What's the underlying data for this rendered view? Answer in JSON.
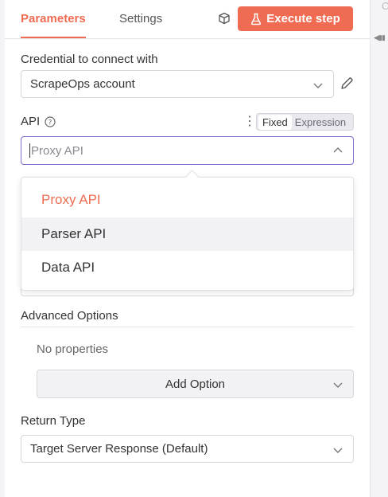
{
  "tabs": {
    "parameters": "Parameters",
    "settings": "Settings"
  },
  "header": {
    "execute_label": "Execute step",
    "accent_color": "#ef6c53"
  },
  "credential": {
    "label": "Credential to connect with",
    "value": "ScrapeOps account"
  },
  "api": {
    "label": "API",
    "mode_fixed": "Fixed",
    "mode_expression": "Expression",
    "input_placeholder": "Proxy API",
    "options": [
      "Proxy API",
      "Parser API",
      "Data API"
    ],
    "selected": "Proxy API",
    "hovered": "Parser API"
  },
  "advanced": {
    "label": "Advanced Options",
    "empty_text": "No properties",
    "add_label": "Add Option"
  },
  "return_type": {
    "label": "Return Type",
    "value": "Target Server Response (Default)"
  },
  "right_strip": {
    "cutoff_text": "C"
  }
}
